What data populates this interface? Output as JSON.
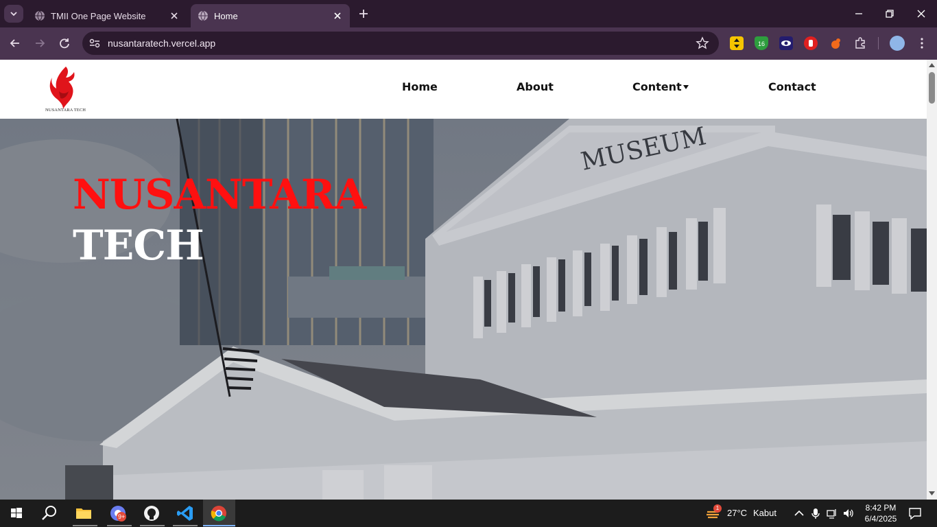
{
  "browser": {
    "tabs": [
      {
        "title": "TMII One Page Website",
        "active": false
      },
      {
        "title": "Home",
        "active": true
      }
    ],
    "url": "nusantaratech.vercel.app"
  },
  "site": {
    "logo_text": "NUSANTARA TECH",
    "nav": [
      {
        "label": "Home"
      },
      {
        "label": "About"
      },
      {
        "label": "Content",
        "has_dropdown": true
      },
      {
        "label": "Contact"
      }
    ],
    "hero": {
      "line1": "NUSANTARA",
      "line2": "TECH",
      "line1_color": "#ff1010",
      "line2_color": "#ffffff",
      "building_sign": "MUSEUM"
    }
  },
  "taskbar": {
    "chrome_badge": "9+",
    "weather_badge": "1",
    "weather_temp": "27°C",
    "weather_desc": "Kabut",
    "time": "8:42 PM",
    "date": "6/4/2025"
  },
  "colors": {
    "tabbar_bg": "#2b1a2e",
    "toolbar_bg": "#4a3450",
    "accent_red": "#ff1010"
  }
}
